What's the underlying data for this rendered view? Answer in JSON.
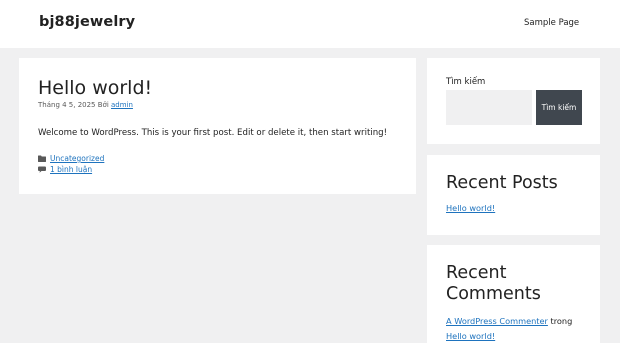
{
  "header": {
    "site_title": "bj88jewelry",
    "nav": [
      "Sample Page"
    ]
  },
  "article": {
    "title": "Hello world!",
    "date": "Tháng 4 5, 2025",
    "by": "Bởi",
    "author": "admin",
    "content": "Welcome to WordPress. This is your first post. Edit or delete it, then start writing!",
    "category": "Uncategorized",
    "comments": "1 bình luận",
    "category_icon": "folder-icon",
    "comment_icon": "comment-icon"
  },
  "sidebar": {
    "search": {
      "label": "Tìm kiếm",
      "placeholder": "",
      "button": "Tìm kiếm"
    },
    "recent_posts": {
      "title": "Recent Posts",
      "items": [
        "Hello world!"
      ]
    },
    "recent_comments": {
      "title": "Recent Comments",
      "author": "A WordPress Commenter",
      "on": "trong",
      "post": "Hello world!"
    }
  },
  "colors": {
    "background": "#f0f0f1",
    "link": "#1e73be",
    "button": "#40474f"
  }
}
